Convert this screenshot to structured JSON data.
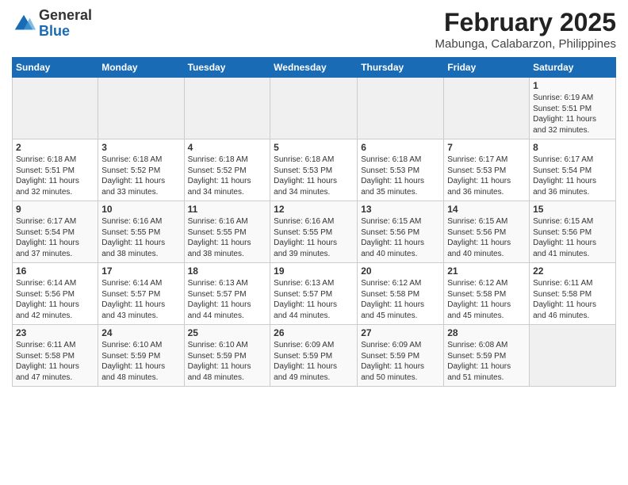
{
  "header": {
    "logo_general": "General",
    "logo_blue": "Blue",
    "month_title": "February 2025",
    "location": "Mabunga, Calabarzon, Philippines"
  },
  "weekdays": [
    "Sunday",
    "Monday",
    "Tuesday",
    "Wednesday",
    "Thursday",
    "Friday",
    "Saturday"
  ],
  "weeks": [
    [
      {
        "day": "",
        "info": ""
      },
      {
        "day": "",
        "info": ""
      },
      {
        "day": "",
        "info": ""
      },
      {
        "day": "",
        "info": ""
      },
      {
        "day": "",
        "info": ""
      },
      {
        "day": "",
        "info": ""
      },
      {
        "day": "1",
        "info": "Sunrise: 6:19 AM\nSunset: 5:51 PM\nDaylight: 11 hours\nand 32 minutes."
      }
    ],
    [
      {
        "day": "2",
        "info": "Sunrise: 6:18 AM\nSunset: 5:51 PM\nDaylight: 11 hours\nand 32 minutes."
      },
      {
        "day": "3",
        "info": "Sunrise: 6:18 AM\nSunset: 5:52 PM\nDaylight: 11 hours\nand 33 minutes."
      },
      {
        "day": "4",
        "info": "Sunrise: 6:18 AM\nSunset: 5:52 PM\nDaylight: 11 hours\nand 34 minutes."
      },
      {
        "day": "5",
        "info": "Sunrise: 6:18 AM\nSunset: 5:53 PM\nDaylight: 11 hours\nand 34 minutes."
      },
      {
        "day": "6",
        "info": "Sunrise: 6:18 AM\nSunset: 5:53 PM\nDaylight: 11 hours\nand 35 minutes."
      },
      {
        "day": "7",
        "info": "Sunrise: 6:17 AM\nSunset: 5:53 PM\nDaylight: 11 hours\nand 36 minutes."
      },
      {
        "day": "8",
        "info": "Sunrise: 6:17 AM\nSunset: 5:54 PM\nDaylight: 11 hours\nand 36 minutes."
      }
    ],
    [
      {
        "day": "9",
        "info": "Sunrise: 6:17 AM\nSunset: 5:54 PM\nDaylight: 11 hours\nand 37 minutes."
      },
      {
        "day": "10",
        "info": "Sunrise: 6:16 AM\nSunset: 5:55 PM\nDaylight: 11 hours\nand 38 minutes."
      },
      {
        "day": "11",
        "info": "Sunrise: 6:16 AM\nSunset: 5:55 PM\nDaylight: 11 hours\nand 38 minutes."
      },
      {
        "day": "12",
        "info": "Sunrise: 6:16 AM\nSunset: 5:55 PM\nDaylight: 11 hours\nand 39 minutes."
      },
      {
        "day": "13",
        "info": "Sunrise: 6:15 AM\nSunset: 5:56 PM\nDaylight: 11 hours\nand 40 minutes."
      },
      {
        "day": "14",
        "info": "Sunrise: 6:15 AM\nSunset: 5:56 PM\nDaylight: 11 hours\nand 40 minutes."
      },
      {
        "day": "15",
        "info": "Sunrise: 6:15 AM\nSunset: 5:56 PM\nDaylight: 11 hours\nand 41 minutes."
      }
    ],
    [
      {
        "day": "16",
        "info": "Sunrise: 6:14 AM\nSunset: 5:56 PM\nDaylight: 11 hours\nand 42 minutes."
      },
      {
        "day": "17",
        "info": "Sunrise: 6:14 AM\nSunset: 5:57 PM\nDaylight: 11 hours\nand 43 minutes."
      },
      {
        "day": "18",
        "info": "Sunrise: 6:13 AM\nSunset: 5:57 PM\nDaylight: 11 hours\nand 44 minutes."
      },
      {
        "day": "19",
        "info": "Sunrise: 6:13 AM\nSunset: 5:57 PM\nDaylight: 11 hours\nand 44 minutes."
      },
      {
        "day": "20",
        "info": "Sunrise: 6:12 AM\nSunset: 5:58 PM\nDaylight: 11 hours\nand 45 minutes."
      },
      {
        "day": "21",
        "info": "Sunrise: 6:12 AM\nSunset: 5:58 PM\nDaylight: 11 hours\nand 45 minutes."
      },
      {
        "day": "22",
        "info": "Sunrise: 6:11 AM\nSunset: 5:58 PM\nDaylight: 11 hours\nand 46 minutes."
      }
    ],
    [
      {
        "day": "23",
        "info": "Sunrise: 6:11 AM\nSunset: 5:58 PM\nDaylight: 11 hours\nand 47 minutes."
      },
      {
        "day": "24",
        "info": "Sunrise: 6:10 AM\nSunset: 5:59 PM\nDaylight: 11 hours\nand 48 minutes."
      },
      {
        "day": "25",
        "info": "Sunrise: 6:10 AM\nSunset: 5:59 PM\nDaylight: 11 hours\nand 48 minutes."
      },
      {
        "day": "26",
        "info": "Sunrise: 6:09 AM\nSunset: 5:59 PM\nDaylight: 11 hours\nand 49 minutes."
      },
      {
        "day": "27",
        "info": "Sunrise: 6:09 AM\nSunset: 5:59 PM\nDaylight: 11 hours\nand 50 minutes."
      },
      {
        "day": "28",
        "info": "Sunrise: 6:08 AM\nSunset: 5:59 PM\nDaylight: 11 hours\nand 51 minutes."
      },
      {
        "day": "",
        "info": ""
      }
    ]
  ]
}
